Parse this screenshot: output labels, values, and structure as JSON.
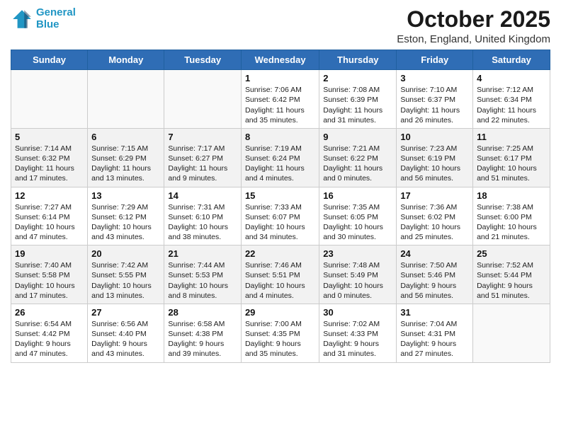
{
  "header": {
    "logo_line1": "General",
    "logo_line2": "Blue",
    "month": "October 2025",
    "location": "Eston, England, United Kingdom"
  },
  "days_of_week": [
    "Sunday",
    "Monday",
    "Tuesday",
    "Wednesday",
    "Thursday",
    "Friday",
    "Saturday"
  ],
  "weeks": [
    [
      {
        "num": "",
        "detail": ""
      },
      {
        "num": "",
        "detail": ""
      },
      {
        "num": "",
        "detail": ""
      },
      {
        "num": "1",
        "detail": "Sunrise: 7:06 AM\nSunset: 6:42 PM\nDaylight: 11 hours\nand 35 minutes."
      },
      {
        "num": "2",
        "detail": "Sunrise: 7:08 AM\nSunset: 6:39 PM\nDaylight: 11 hours\nand 31 minutes."
      },
      {
        "num": "3",
        "detail": "Sunrise: 7:10 AM\nSunset: 6:37 PM\nDaylight: 11 hours\nand 26 minutes."
      },
      {
        "num": "4",
        "detail": "Sunrise: 7:12 AM\nSunset: 6:34 PM\nDaylight: 11 hours\nand 22 minutes."
      }
    ],
    [
      {
        "num": "5",
        "detail": "Sunrise: 7:14 AM\nSunset: 6:32 PM\nDaylight: 11 hours\nand 17 minutes."
      },
      {
        "num": "6",
        "detail": "Sunrise: 7:15 AM\nSunset: 6:29 PM\nDaylight: 11 hours\nand 13 minutes."
      },
      {
        "num": "7",
        "detail": "Sunrise: 7:17 AM\nSunset: 6:27 PM\nDaylight: 11 hours\nand 9 minutes."
      },
      {
        "num": "8",
        "detail": "Sunrise: 7:19 AM\nSunset: 6:24 PM\nDaylight: 11 hours\nand 4 minutes."
      },
      {
        "num": "9",
        "detail": "Sunrise: 7:21 AM\nSunset: 6:22 PM\nDaylight: 11 hours\nand 0 minutes."
      },
      {
        "num": "10",
        "detail": "Sunrise: 7:23 AM\nSunset: 6:19 PM\nDaylight: 10 hours\nand 56 minutes."
      },
      {
        "num": "11",
        "detail": "Sunrise: 7:25 AM\nSunset: 6:17 PM\nDaylight: 10 hours\nand 51 minutes."
      }
    ],
    [
      {
        "num": "12",
        "detail": "Sunrise: 7:27 AM\nSunset: 6:14 PM\nDaylight: 10 hours\nand 47 minutes."
      },
      {
        "num": "13",
        "detail": "Sunrise: 7:29 AM\nSunset: 6:12 PM\nDaylight: 10 hours\nand 43 minutes."
      },
      {
        "num": "14",
        "detail": "Sunrise: 7:31 AM\nSunset: 6:10 PM\nDaylight: 10 hours\nand 38 minutes."
      },
      {
        "num": "15",
        "detail": "Sunrise: 7:33 AM\nSunset: 6:07 PM\nDaylight: 10 hours\nand 34 minutes."
      },
      {
        "num": "16",
        "detail": "Sunrise: 7:35 AM\nSunset: 6:05 PM\nDaylight: 10 hours\nand 30 minutes."
      },
      {
        "num": "17",
        "detail": "Sunrise: 7:36 AM\nSunset: 6:02 PM\nDaylight: 10 hours\nand 25 minutes."
      },
      {
        "num": "18",
        "detail": "Sunrise: 7:38 AM\nSunset: 6:00 PM\nDaylight: 10 hours\nand 21 minutes."
      }
    ],
    [
      {
        "num": "19",
        "detail": "Sunrise: 7:40 AM\nSunset: 5:58 PM\nDaylight: 10 hours\nand 17 minutes."
      },
      {
        "num": "20",
        "detail": "Sunrise: 7:42 AM\nSunset: 5:55 PM\nDaylight: 10 hours\nand 13 minutes."
      },
      {
        "num": "21",
        "detail": "Sunrise: 7:44 AM\nSunset: 5:53 PM\nDaylight: 10 hours\nand 8 minutes."
      },
      {
        "num": "22",
        "detail": "Sunrise: 7:46 AM\nSunset: 5:51 PM\nDaylight: 10 hours\nand 4 minutes."
      },
      {
        "num": "23",
        "detail": "Sunrise: 7:48 AM\nSunset: 5:49 PM\nDaylight: 10 hours\nand 0 minutes."
      },
      {
        "num": "24",
        "detail": "Sunrise: 7:50 AM\nSunset: 5:46 PM\nDaylight: 9 hours\nand 56 minutes."
      },
      {
        "num": "25",
        "detail": "Sunrise: 7:52 AM\nSunset: 5:44 PM\nDaylight: 9 hours\nand 51 minutes."
      }
    ],
    [
      {
        "num": "26",
        "detail": "Sunrise: 6:54 AM\nSunset: 4:42 PM\nDaylight: 9 hours\nand 47 minutes."
      },
      {
        "num": "27",
        "detail": "Sunrise: 6:56 AM\nSunset: 4:40 PM\nDaylight: 9 hours\nand 43 minutes."
      },
      {
        "num": "28",
        "detail": "Sunrise: 6:58 AM\nSunset: 4:38 PM\nDaylight: 9 hours\nand 39 minutes."
      },
      {
        "num": "29",
        "detail": "Sunrise: 7:00 AM\nSunset: 4:35 PM\nDaylight: 9 hours\nand 35 minutes."
      },
      {
        "num": "30",
        "detail": "Sunrise: 7:02 AM\nSunset: 4:33 PM\nDaylight: 9 hours\nand 31 minutes."
      },
      {
        "num": "31",
        "detail": "Sunrise: 7:04 AM\nSunset: 4:31 PM\nDaylight: 9 hours\nand 27 minutes."
      },
      {
        "num": "",
        "detail": ""
      }
    ]
  ]
}
